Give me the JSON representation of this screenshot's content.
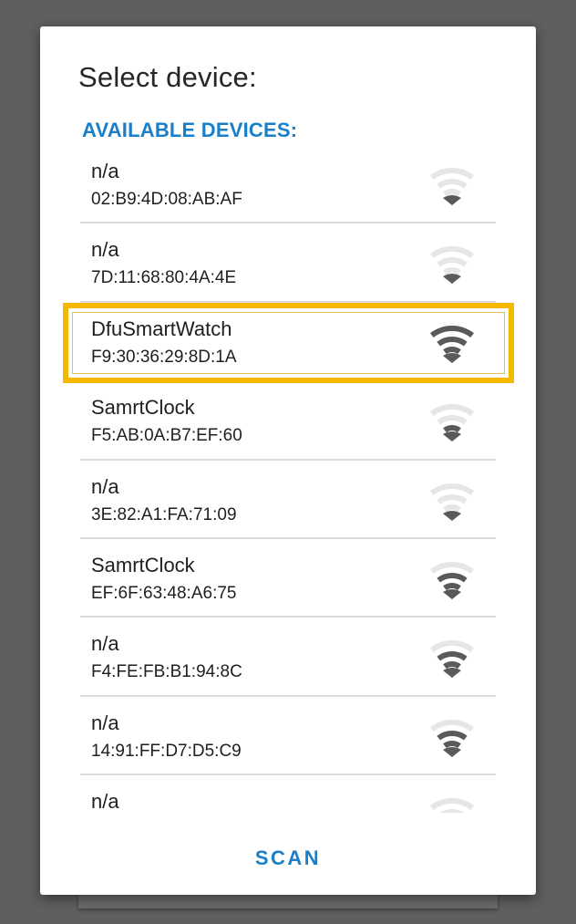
{
  "dialog": {
    "title": "Select device:",
    "section_header": "AVAILABLE DEVICES:",
    "scan_label": "SCAN"
  },
  "colors": {
    "accent": "#1a7fc9",
    "highlight": "#f5b800",
    "signal_active": "#5a5a5a",
    "signal_inactive": "#e6e6e6"
  },
  "devices": [
    {
      "name": "n/a",
      "address": "02:B9:4D:08:AB:AF",
      "signal_bars": 1,
      "signal_icon": "wifi-signal-icon"
    },
    {
      "name": "n/a",
      "address": "7D:11:68:80:4A:4E",
      "signal_bars": 1,
      "signal_icon": "wifi-signal-icon"
    },
    {
      "name": "DfuSmartWatch",
      "address": "F9:30:36:29:8D:1A",
      "signal_bars": 4,
      "signal_icon": "wifi-signal-icon",
      "highlighted": true
    },
    {
      "name": "SamrtClock",
      "address": "F5:AB:0A:B7:EF:60",
      "signal_bars": 2,
      "signal_icon": "wifi-signal-icon"
    },
    {
      "name": "n/a",
      "address": "3E:82:A1:FA:71:09",
      "signal_bars": 1,
      "signal_icon": "wifi-signal-icon"
    },
    {
      "name": "SamrtClock",
      "address": "EF:6F:63:48:A6:75",
      "signal_bars": 3,
      "signal_icon": "wifi-signal-icon"
    },
    {
      "name": "n/a",
      "address": "F4:FE:FB:B1:94:8C",
      "signal_bars": 3,
      "signal_icon": "wifi-signal-icon"
    },
    {
      "name": "n/a",
      "address": "14:91:FF:D7:D5:C9",
      "signal_bars": 3,
      "signal_icon": "wifi-signal-icon"
    },
    {
      "name": "n/a",
      "address": "",
      "signal_bars": 0,
      "signal_icon": "wifi-signal-icon"
    }
  ]
}
